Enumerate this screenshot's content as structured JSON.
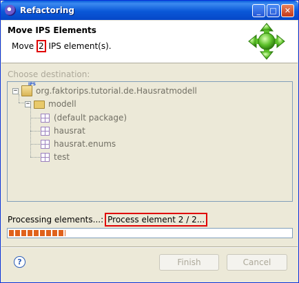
{
  "window": {
    "title": "Refactoring",
    "buttons": {
      "minimize": "_",
      "maximize": "□",
      "close": "✕"
    }
  },
  "header": {
    "title": "Move IPS Elements",
    "message_prefix": "Move ",
    "message_count": "2",
    "message_suffix": " IPS element(s).",
    "icon": "move-arrows-icon",
    "highlight_color": "#e00000"
  },
  "destination": {
    "label": "Choose destination:",
    "tree": [
      {
        "label": "org.faktorips.tutorial.de.Hausratmodell",
        "icon": "ips-project-icon",
        "expander": "−",
        "level": 0
      },
      {
        "label": "modell",
        "icon": "folder-icon",
        "expander": "−",
        "level": 1
      },
      {
        "label": "(default package)",
        "icon": "package-icon",
        "level": 2
      },
      {
        "label": "hausrat",
        "icon": "package-icon",
        "level": 2
      },
      {
        "label": "hausrat.enums",
        "icon": "package-icon",
        "level": 2
      },
      {
        "label": "test",
        "icon": "package-icon",
        "level": 2
      }
    ]
  },
  "progress": {
    "label": "Processing elements...:",
    "status": "Process element 2 / 2...",
    "fraction": 0.2,
    "bar_color": "#e0621c"
  },
  "buttons": {
    "help": "?",
    "finish": "Finish",
    "cancel": "Cancel"
  }
}
